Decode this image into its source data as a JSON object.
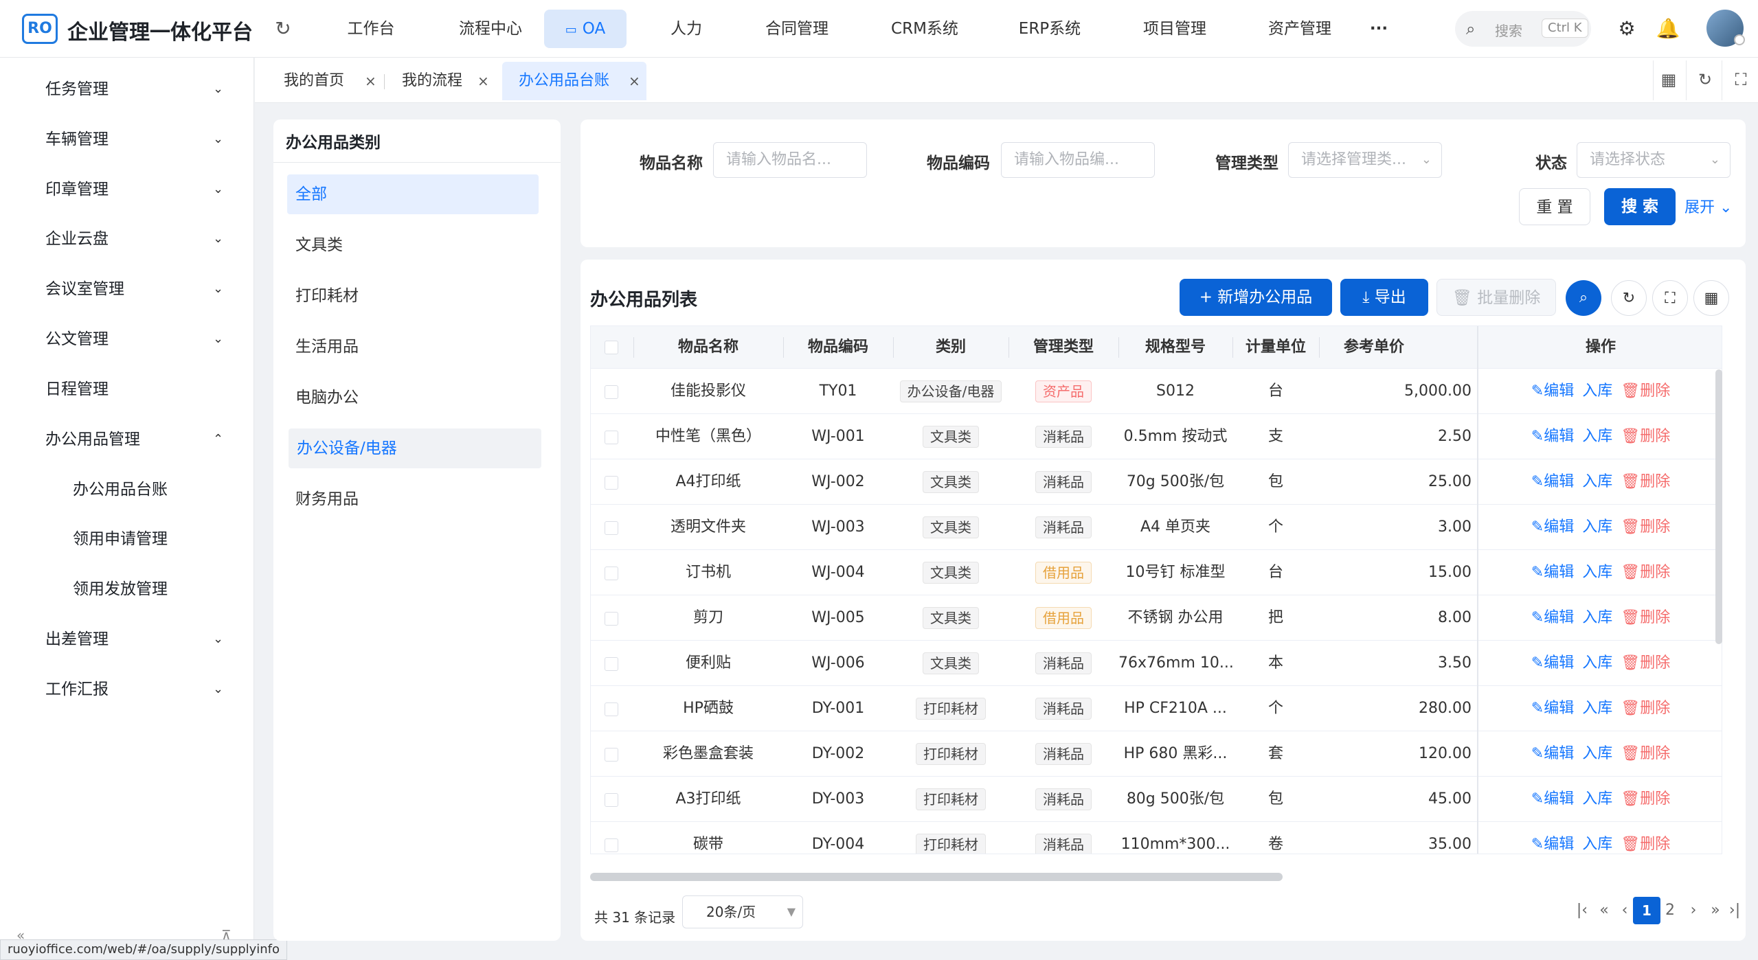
{
  "app": {
    "logo_text": "RO",
    "title": "企业管理一体化平台"
  },
  "topnav": {
    "items": [
      "工作台",
      "流程中心",
      "OA",
      "人力",
      "合同管理",
      "CRM系统",
      "ERP系统",
      "项目管理",
      "资产管理",
      "···"
    ],
    "search_placeholder": "搜索",
    "search_shortcut": "Ctrl K"
  },
  "sidebar": {
    "items": [
      {
        "label": "任务管理",
        "chev": "⌄"
      },
      {
        "label": "车辆管理",
        "chev": "⌄"
      },
      {
        "label": "印章管理",
        "chev": "⌄"
      },
      {
        "label": "企业云盘",
        "chev": "⌄"
      },
      {
        "label": "会议室管理",
        "chev": "⌄"
      },
      {
        "label": "公文管理",
        "chev": "⌄"
      },
      {
        "label": "日程管理",
        "chev": ""
      },
      {
        "label": "办公用品管理",
        "chev": "⌃"
      },
      {
        "label": "办公用品台账",
        "chev": ""
      },
      {
        "label": "领用申请管理",
        "chev": ""
      },
      {
        "label": "领用发放管理",
        "chev": ""
      },
      {
        "label": "出差管理",
        "chev": "⌄"
      },
      {
        "label": "工作汇报",
        "chev": "⌄"
      }
    ]
  },
  "status_url": "ruoyioffice.com/web/#/oa/supply/supplyinfo",
  "tabs": [
    {
      "label": "我的首页",
      "close": "×"
    },
    {
      "label": "我的流程",
      "close": "×"
    },
    {
      "label": "办公用品台账",
      "close": "×"
    }
  ],
  "category": {
    "title": "办公用品类别",
    "items": [
      "全部",
      "文具类",
      "打印耗材",
      "生活用品",
      "电脑办公",
      "办公设备/电器",
      "财务用品"
    ]
  },
  "filter": {
    "name_label": "物品名称",
    "name_placeholder": "请输入物品名...",
    "code_label": "物品编码",
    "code_placeholder": "请输入物品编...",
    "type_label": "管理类型",
    "type_placeholder": "请选择管理类...",
    "status_label": "状态",
    "status_placeholder": "请选择状态",
    "reset": "重 置",
    "search": "搜 索",
    "expand": "展开"
  },
  "list": {
    "title": "办公用品列表",
    "add": "+ 新增办公用品",
    "export": "⤓ 导出",
    "batch_delete": "🗑 批量删除",
    "columns": [
      "物品名称",
      "物品编码",
      "类别",
      "管理类型",
      "规格型号",
      "计量单位",
      "参考单价",
      "操作"
    ],
    "op_edit": "编辑",
    "op_in": "入库",
    "op_delete": "删除",
    "rows": [
      {
        "name": "佳能投影仪",
        "code": "TY01",
        "category": "办公设备/电器",
        "type": "资产品",
        "tone": "red",
        "spec": "S012",
        "unit": "台",
        "price": "5,000.00"
      },
      {
        "name": "中性笔（黑色）",
        "code": "WJ-001",
        "category": "文具类",
        "type": "消耗品",
        "tone": "gray",
        "spec": "0.5mm 按动式",
        "unit": "支",
        "price": "2.50"
      },
      {
        "name": "A4打印纸",
        "code": "WJ-002",
        "category": "文具类",
        "type": "消耗品",
        "tone": "gray",
        "spec": "70g 500张/包",
        "unit": "包",
        "price": "25.00"
      },
      {
        "name": "透明文件夹",
        "code": "WJ-003",
        "category": "文具类",
        "type": "消耗品",
        "tone": "gray",
        "spec": "A4 单页夹",
        "unit": "个",
        "price": "3.00"
      },
      {
        "name": "订书机",
        "code": "WJ-004",
        "category": "文具类",
        "type": "借用品",
        "tone": "orange",
        "spec": "10号钉 标准型",
        "unit": "台",
        "price": "15.00"
      },
      {
        "name": "剪刀",
        "code": "WJ-005",
        "category": "文具类",
        "type": "借用品",
        "tone": "orange",
        "spec": "不锈钢 办公用",
        "unit": "把",
        "price": "8.00"
      },
      {
        "name": "便利贴",
        "code": "WJ-006",
        "category": "文具类",
        "type": "消耗品",
        "tone": "gray",
        "spec": "76x76mm 10...",
        "unit": "本",
        "price": "3.50"
      },
      {
        "name": "HP硒鼓",
        "code": "DY-001",
        "category": "打印耗材",
        "type": "消耗品",
        "tone": "gray",
        "spec": "HP CF210A ...",
        "unit": "个",
        "price": "280.00"
      },
      {
        "name": "彩色墨盒套装",
        "code": "DY-002",
        "category": "打印耗材",
        "type": "消耗品",
        "tone": "gray",
        "spec": "HP 680 黑彩...",
        "unit": "套",
        "price": "120.00"
      },
      {
        "name": "A3打印纸",
        "code": "DY-003",
        "category": "打印耗材",
        "type": "消耗品",
        "tone": "gray",
        "spec": "80g 500张/包",
        "unit": "包",
        "price": "45.00"
      },
      {
        "name": "碳带",
        "code": "DY-004",
        "category": "打印耗材",
        "type": "消耗品",
        "tone": "gray",
        "spec": "110mm*300...",
        "unit": "卷",
        "price": "35.00"
      }
    ]
  },
  "pagination": {
    "total": "共 31 条记录",
    "page_size": "20条/页",
    "pages": [
      "1",
      "2"
    ],
    "first": "|‹",
    "prev_fast": "«",
    "prev": "‹",
    "next": "›",
    "next_fast": "»",
    "last": "›|"
  }
}
